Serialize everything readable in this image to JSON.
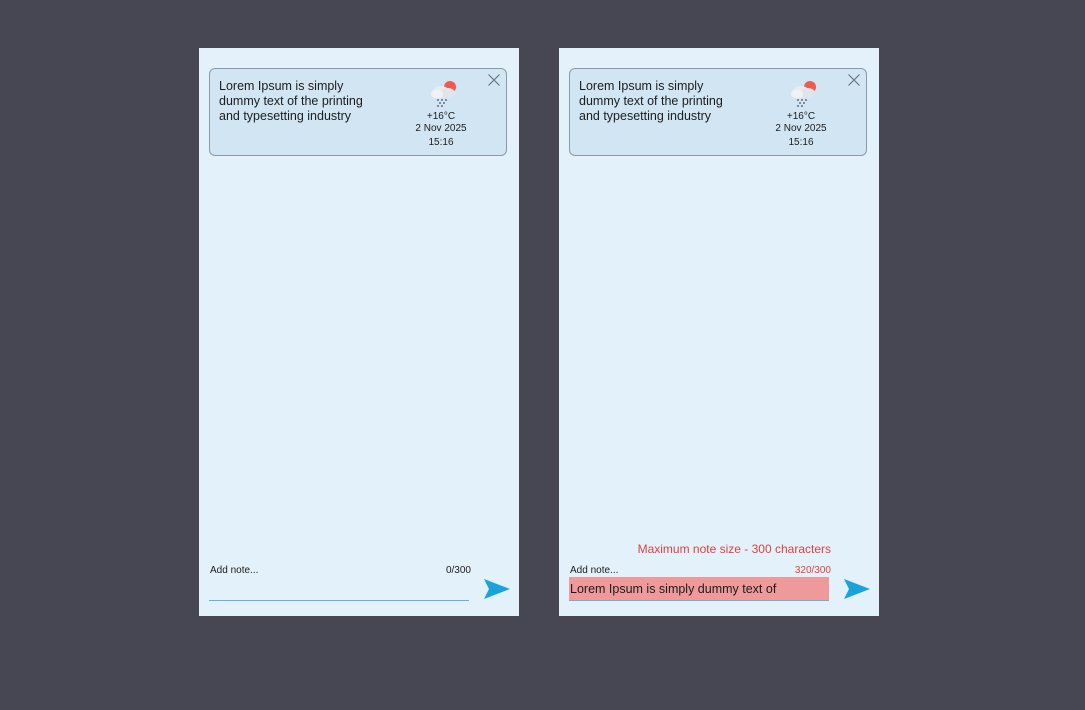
{
  "colors": {
    "background": "#464753",
    "panel": "#e3f1fa",
    "card": "#d1e5f3",
    "accent": "#1aa3d9",
    "error": "#e0413f",
    "error_fill": "#ef9a9a"
  },
  "left": {
    "note": {
      "text": "Lorem Ipsum is simply dummy text of the printing and typesetting industry",
      "weather_icon": "cloud-rain-sun-icon",
      "temperature": "+16°C",
      "date": "2 Nov 2025",
      "time": "15:16"
    },
    "input": {
      "label": "Add note...",
      "counter": "0/300",
      "value": "",
      "placeholder": ""
    }
  },
  "right": {
    "note": {
      "text": "Lorem Ipsum is simply dummy text of the printing and typesetting industry",
      "weather_icon": "cloud-rain-sun-icon",
      "temperature": "+16°C",
      "date": "2 Nov 2025",
      "time": "15:16"
    },
    "error_message": "Maximum note size - 300 characters",
    "input": {
      "label": "Add note...",
      "counter": "320/300",
      "value": "Lorem Ipsum is simply dummy text of",
      "placeholder": ""
    }
  }
}
